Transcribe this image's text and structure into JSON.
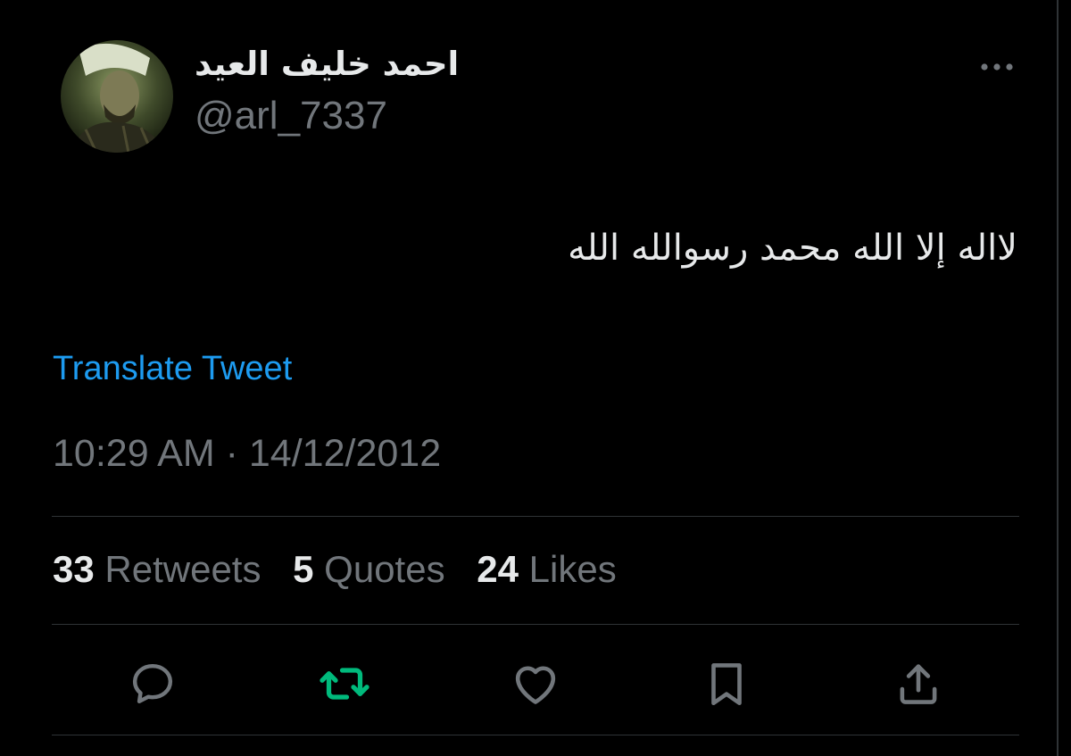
{
  "user": {
    "display_name": "احمد خليف العيد",
    "handle": "@arl_7337",
    "avatar_icon": "profile-photo"
  },
  "tweet": {
    "text": "لااله إلا الله محمد رسوالله الله",
    "translate_label": "Translate Tweet",
    "timestamp": "10:29 AM · 14/12/2012"
  },
  "stats": {
    "retweets_count": "33",
    "retweets_label": "Retweets",
    "quotes_count": "5",
    "quotes_label": "Quotes",
    "likes_count": "24",
    "likes_label": "Likes"
  },
  "actions": [
    {
      "name": "reply",
      "icon": "speech-bubble-icon"
    },
    {
      "name": "retweet",
      "icon": "retweet-arrows-icon",
      "active": true
    },
    {
      "name": "like",
      "icon": "heart-icon"
    },
    {
      "name": "bookmark",
      "icon": "bookmark-icon"
    },
    {
      "name": "share",
      "icon": "share-upload-icon"
    }
  ],
  "colors": {
    "background": "#000000",
    "primary_text": "#e7e9ea",
    "secondary_text": "#71767b",
    "link": "#1d9bf0",
    "retweet_active": "#00ba7c",
    "divider": "#2f3336"
  }
}
